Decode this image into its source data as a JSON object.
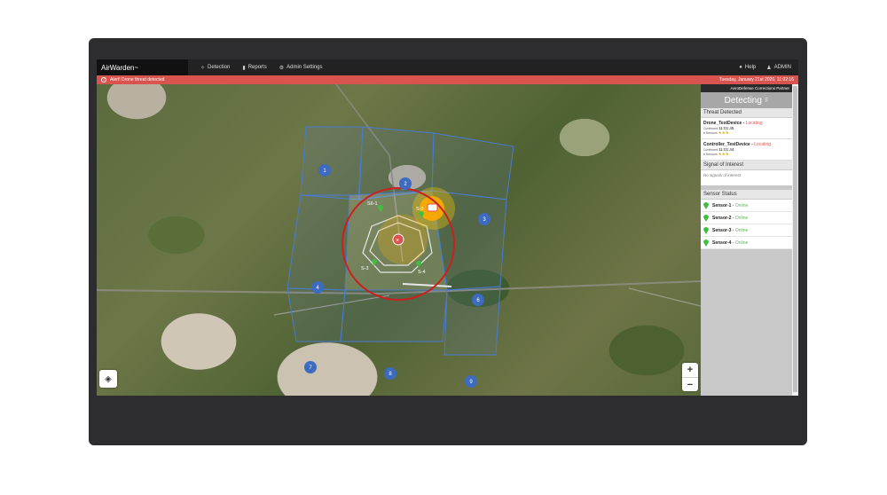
{
  "app": {
    "brand": "AirWarden",
    "brand_tm": "™"
  },
  "nav": {
    "items": [
      {
        "label": "Detection",
        "icon": "crosshair-icon"
      },
      {
        "label": "Reports",
        "icon": "bar-chart-icon"
      },
      {
        "label": "Admin Settings",
        "icon": "gears-icon"
      }
    ],
    "help": "Help",
    "admin": "ADMIN"
  },
  "alert": {
    "message": "Alert! Drone threat detected",
    "datetime": "Tuesday, January 21st 2020, 11:02:16",
    "color": "#d9534f"
  },
  "panel": {
    "partner": "AeroDefense Corrections Partner",
    "detecting": "Detecting",
    "threat_header": "Threat Detected",
    "threats": [
      {
        "name": "Drone_TestDevice",
        "status": "Locating",
        "confirmed_label": "Confirmed",
        "time": "11:01:45",
        "sensors_label": "# Sensors"
      },
      {
        "name": "Controller_TestDevice",
        "status": "Locating",
        "confirmed_label": "Confirmed",
        "time": "11:01:44",
        "sensors_label": "# Sensors"
      }
    ],
    "soi_header": "Signal of Interest",
    "soi_empty": "No signals of interest",
    "sensor_header": "Sensor Status",
    "sensors": [
      {
        "name": "Sensor-1",
        "status": "Online"
      },
      {
        "name": "Sensor-2",
        "status": "Online"
      },
      {
        "name": "Sensor-3",
        "status": "Online"
      },
      {
        "name": "Sensor-4",
        "status": "Online"
      }
    ]
  },
  "map": {
    "zones": [
      "1",
      "2",
      "3",
      "4",
      "5",
      "6",
      "7",
      "8",
      "9"
    ],
    "sensor_labels": [
      "S6-1",
      "S-2",
      "S-3",
      "S-4"
    ],
    "zoom_in": "+",
    "zoom_out": "−",
    "radius_color": "#cc1f1f",
    "grid_color": "#4a7bd0"
  }
}
